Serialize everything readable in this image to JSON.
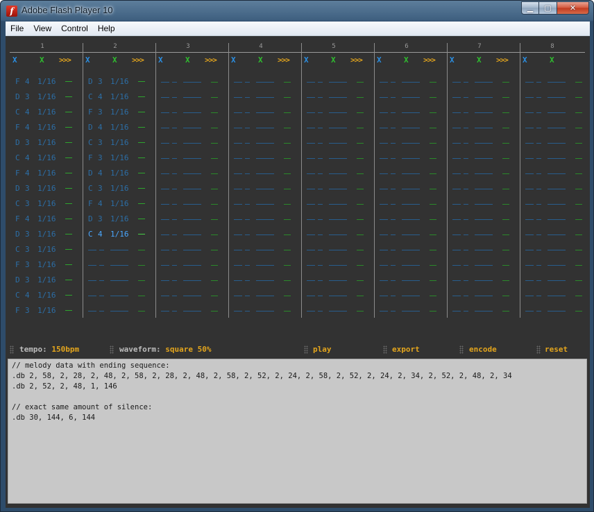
{
  "window": {
    "title": "Adobe Flash Player 10",
    "min_label": "▁",
    "max_label": "▢",
    "close_label": "✕"
  },
  "menu": [
    "File",
    "View",
    "Control",
    "Help"
  ],
  "channels": [
    {
      "number": "1",
      "delete": "X",
      "mute": "X",
      "next": ">>>",
      "notes": [
        {
          "pitch": "F",
          "octave": "4",
          "length": "1/16"
        },
        {
          "pitch": "D",
          "octave": "3",
          "length": "1/16"
        },
        {
          "pitch": "C",
          "octave": "4",
          "length": "1/16"
        },
        {
          "pitch": "F",
          "octave": "4",
          "length": "1/16"
        },
        {
          "pitch": "D",
          "octave": "3",
          "length": "1/16"
        },
        {
          "pitch": "C",
          "octave": "4",
          "length": "1/16"
        },
        {
          "pitch": "F",
          "octave": "4",
          "length": "1/16"
        },
        {
          "pitch": "D",
          "octave": "3",
          "length": "1/16"
        },
        {
          "pitch": "C",
          "octave": "3",
          "length": "1/16"
        },
        {
          "pitch": "F",
          "octave": "4",
          "length": "1/16"
        },
        {
          "pitch": "D",
          "octave": "3",
          "length": "1/16"
        },
        {
          "pitch": "C",
          "octave": "3",
          "length": "1/16"
        },
        {
          "pitch": "F",
          "octave": "3",
          "length": "1/16"
        },
        {
          "pitch": "D",
          "octave": "3",
          "length": "1/16"
        },
        {
          "pitch": "C",
          "octave": "4",
          "length": "1/16"
        },
        {
          "pitch": "F",
          "octave": "3",
          "length": "1/16"
        }
      ]
    },
    {
      "number": "2",
      "delete": "X",
      "mute": "X",
      "next": ">>>",
      "notes": [
        {
          "pitch": "D",
          "octave": "3",
          "length": "1/16"
        },
        {
          "pitch": "C",
          "octave": "4",
          "length": "1/16"
        },
        {
          "pitch": "F",
          "octave": "3",
          "length": "1/16"
        },
        {
          "pitch": "D",
          "octave": "4",
          "length": "1/16"
        },
        {
          "pitch": "C",
          "octave": "3",
          "length": "1/16"
        },
        {
          "pitch": "F",
          "octave": "3",
          "length": "1/16"
        },
        {
          "pitch": "D",
          "octave": "4",
          "length": "1/16"
        },
        {
          "pitch": "C",
          "octave": "3",
          "length": "1/16"
        },
        {
          "pitch": "F",
          "octave": "4",
          "length": "1/16"
        },
        {
          "pitch": "D",
          "octave": "3",
          "length": "1/16"
        },
        {
          "pitch": "C",
          "octave": "4",
          "length": "1/16",
          "active": true
        }
      ]
    },
    {
      "number": "3",
      "delete": "X",
      "mute": "X",
      "next": ">>>",
      "notes": []
    },
    {
      "number": "4",
      "delete": "X",
      "mute": "X",
      "next": ">>>",
      "notes": []
    },
    {
      "number": "5",
      "delete": "X",
      "mute": "X",
      "next": ">>>",
      "notes": []
    },
    {
      "number": "6",
      "delete": "X",
      "mute": "X",
      "next": ">>>",
      "notes": []
    },
    {
      "number": "7",
      "delete": "X",
      "mute": "X",
      "next": ">>>",
      "notes": []
    },
    {
      "number": "8",
      "delete": "X",
      "mute": "X",
      "next": "",
      "notes": []
    }
  ],
  "controls": {
    "tempo_label": "tempo:",
    "tempo_value": "150bpm",
    "waveform_label": "waveform:",
    "waveform_value": "square 50%",
    "play": "play",
    "export": "export",
    "encode": "encode",
    "reset": "reset"
  },
  "code_text": "// melody data with ending sequence:\n.db 2, 58, 2, 28, 2, 48, 2, 58, 2, 28, 2, 48, 2, 58, 2, 52, 2, 24, 2, 58, 2, 52, 2, 24, 2, 34, 2, 52, 2, 48, 2, 34\n.db 2, 52, 2, 48, 1, 146\n\n// exact same amount of silence:\n.db 30, 144, 6, 144",
  "colors": {
    "note": "#2c6ea6",
    "active_note": "#4aa7ff",
    "delete": "#2b8fe3",
    "mute": "#2fbf2f",
    "accent": "#e3a51d",
    "background": "#323232"
  }
}
